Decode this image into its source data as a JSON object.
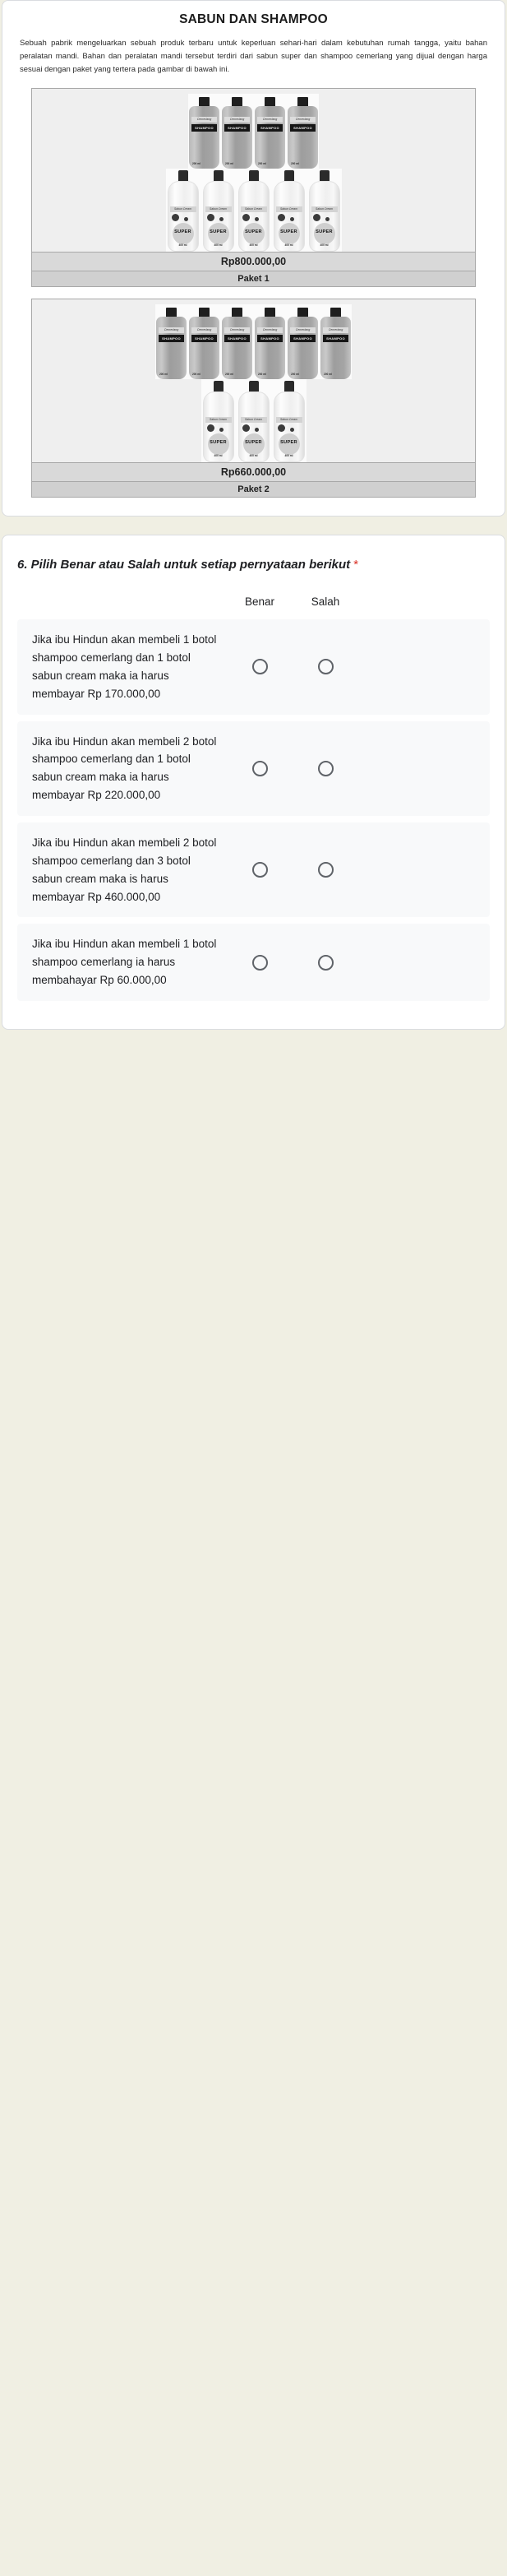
{
  "stimulus": {
    "title": "SABUN DAN SHAMPOO",
    "paragraph": "Sebuah pabrik mengeluarkan sebuah produk terbaru untuk keperluan sehari-hari dalam kebutuhan rumah tangga, yaitu bahan peralatan mandi. Bahan dan peralatan mandi tersebut terdiri dari sabun super dan shampoo cemerlang yang dijual dengan harga sesuai dengan paket yang tertera pada gambar di bawah ini.",
    "packages": [
      {
        "shampoo_count": 4,
        "soap_count": 5,
        "price": "Rp800.000,00",
        "name": "Paket 1",
        "shampoo_brand": "Cemerlang",
        "shampoo_label": "SHAMPOO",
        "shampoo_volume": "200 ml",
        "soap_brand": "Sabun Cream",
        "soap_label": "SUPER",
        "soap_volume": "400 ml"
      },
      {
        "shampoo_count": 6,
        "soap_count": 3,
        "price": "Rp660.000,00",
        "name": "Paket 2",
        "shampoo_brand": "Cemerlang",
        "shampoo_label": "SHAMPOO",
        "shampoo_volume": "200 ml",
        "soap_brand": "Sabun Cream",
        "soap_label": "SUPER",
        "soap_volume": "400 ml"
      }
    ]
  },
  "question": {
    "title": "6. Pilih Benar atau Salah untuk setiap pernyataan berikut",
    "required_marker": "*",
    "columns": [
      "Benar",
      "Salah"
    ],
    "rows": [
      {
        "statement": "Jika ibu Hindun akan membeli 1 botol shampoo cemerlang dan 1 botol sabun cream maka ia harus membayar Rp 170.000,00",
        "options": [
          "Benar",
          "Salah"
        ],
        "selected": null
      },
      {
        "statement": "Jika ibu Hindun akan membeli 2 botol shampoo cemerlang dan 1 botol sabun cream maka ia harus membayar Rp 220.000,00",
        "options": [
          "Benar",
          "Salah"
        ],
        "selected": null
      },
      {
        "statement": "Jika ibu Hindun akan membeli 2 botol shampoo cemerlang dan 3 botol sabun cream maka is harus membayar Rp 460.000,00",
        "options": [
          "Benar",
          "Salah"
        ],
        "selected": null
      },
      {
        "statement": "Jika  ibu Hindun akan membeli 1 botol shampoo cemerlang ia harus membahayar Rp 60.000,00",
        "options": [
          "Benar",
          "Salah"
        ],
        "selected": null
      }
    ]
  },
  "colors": {
    "page_background": "#f0efe3",
    "card_background": "#ffffff",
    "row_background": "#f8f9fa",
    "required_red": "#d93025",
    "radio_border": "#5f6368"
  }
}
